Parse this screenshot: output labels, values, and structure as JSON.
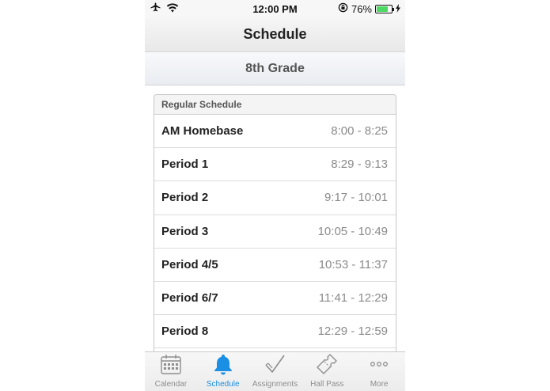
{
  "status": {
    "time": "12:00 PM",
    "battery": "76%",
    "battery_level": 0.76
  },
  "nav": {
    "title": "Schedule"
  },
  "grade": {
    "label": "8th Grade"
  },
  "schedule": {
    "header": "Regular Schedule",
    "rows": [
      {
        "name": "AM Homebase",
        "time": "8:00 - 8:25"
      },
      {
        "name": "Period 1",
        "time": "8:29 - 9:13"
      },
      {
        "name": "Period 2",
        "time": "9:17 - 10:01"
      },
      {
        "name": "Period 3",
        "time": "10:05 - 10:49"
      },
      {
        "name": "Period 4/5",
        "time": "10:53 - 11:37"
      },
      {
        "name": "Period 6/7",
        "time": "11:41 - 12:29"
      },
      {
        "name": "Period 8",
        "time": "12:29 - 12:59"
      }
    ]
  },
  "tabs": [
    {
      "label": "Calendar",
      "icon": "calendar-icon"
    },
    {
      "label": "Schedule",
      "icon": "bell-icon",
      "active": true
    },
    {
      "label": "Assignments",
      "icon": "checkmark-icon"
    },
    {
      "label": "Hall Pass",
      "icon": "ticket-icon"
    },
    {
      "label": "More",
      "icon": "more-icon"
    }
  ],
  "colors": {
    "accent": "#1a8fe3",
    "battery": "#4cd964"
  }
}
